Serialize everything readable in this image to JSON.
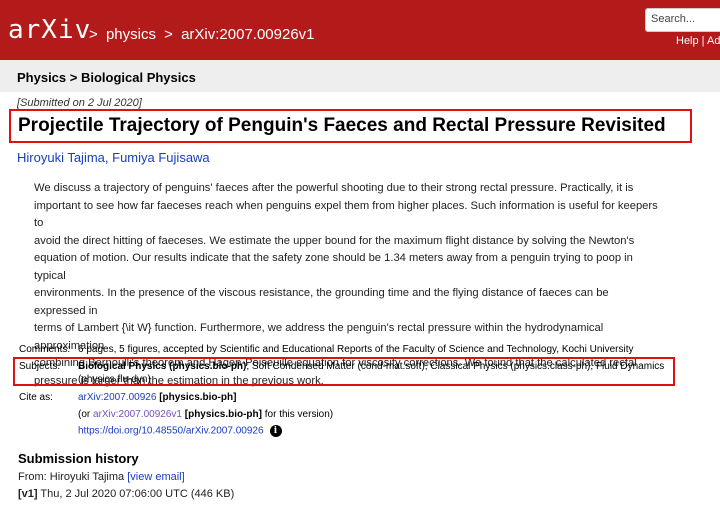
{
  "header": {
    "logo": "arXiv",
    "breadcrumb": [
      ">",
      "physics",
      ">",
      "arXiv:2007.00926v1"
    ],
    "search_placeholder": "Search...",
    "help_link": "Help | Adv"
  },
  "subject_bar": {
    "text": "Physics > Biological Physics"
  },
  "paper": {
    "submitted": "[Submitted on 2 Jul 2020]",
    "title": "Projectile Trajectory of Penguin's Faeces and Rectal Pressure Revisited",
    "authors": [
      "Hiroyuki Tajima",
      "Fumiya Fujisawa"
    ],
    "author_sep": ", ",
    "abstract_lines": [
      "We discuss a trajectory of penguins' faeces after the powerful shooting due to their strong rectal pressure. Practically, it is",
      "important to see how far faeceses reach when penguins expel them from higher places. Such information is useful for keepers to",
      "avoid the direct hitting of faeceses. We estimate the upper bound for the maximum flight distance by solving the Newton's",
      "equation of motion. Our results indicate that the safety zone should be 1.34 meters away from a penguin trying to poop in typical",
      "environments. In the presence of the viscous resistance, the grounding time and the flying distance of faeces can be expressed in",
      "terms of Lambert {\\it W} function. Furthermore, we address the penguin's rectal pressure within the hydrodynamical approximation",
      "combining Bernoulli's theorem and Hagen-Poiseuille equation for viscosity corrections. We found that the calculated rectal",
      "pressure is larger than the estimation in the previous work."
    ]
  },
  "metadata": {
    "comments_label": "Comments:",
    "comments": "6 pages, 5 figures, accepted by Scientific and Educational Reports of the Faculty of Science and Technology, Kochi University",
    "subjects_label": "Subjects:",
    "subjects_primary": "Biological Physics (physics.bio-ph)",
    "subjects_rest_1": "; Soft Condensed Matter (cond-mat.soft); Classical Physics (physics.class-ph); Fluid Dynamics",
    "subjects_rest_2": "(physics.flu-dyn)",
    "cite_label": "Cite as:",
    "cite_id": "arXiv:2007.00926",
    "cite_cat": "[physics.bio-ph]",
    "cite_v_prefix": "(or ",
    "cite_v_id": "arXiv:2007.00926v1",
    "cite_v_cat": "[physics.bio-ph]",
    "cite_v_suffix": " for this version)",
    "doi": "https://doi.org/10.48550/arXiv.2007.00926",
    "info_icon": "i"
  },
  "history": {
    "title": "Submission history",
    "from_prefix": "From: Hiroyuki Tajima ",
    "view_email": "[view email]",
    "v1_label": "[v1]",
    "v1_text": " Thu, 2 Jul 2020 07:06:00 UTC (446 KB)"
  }
}
